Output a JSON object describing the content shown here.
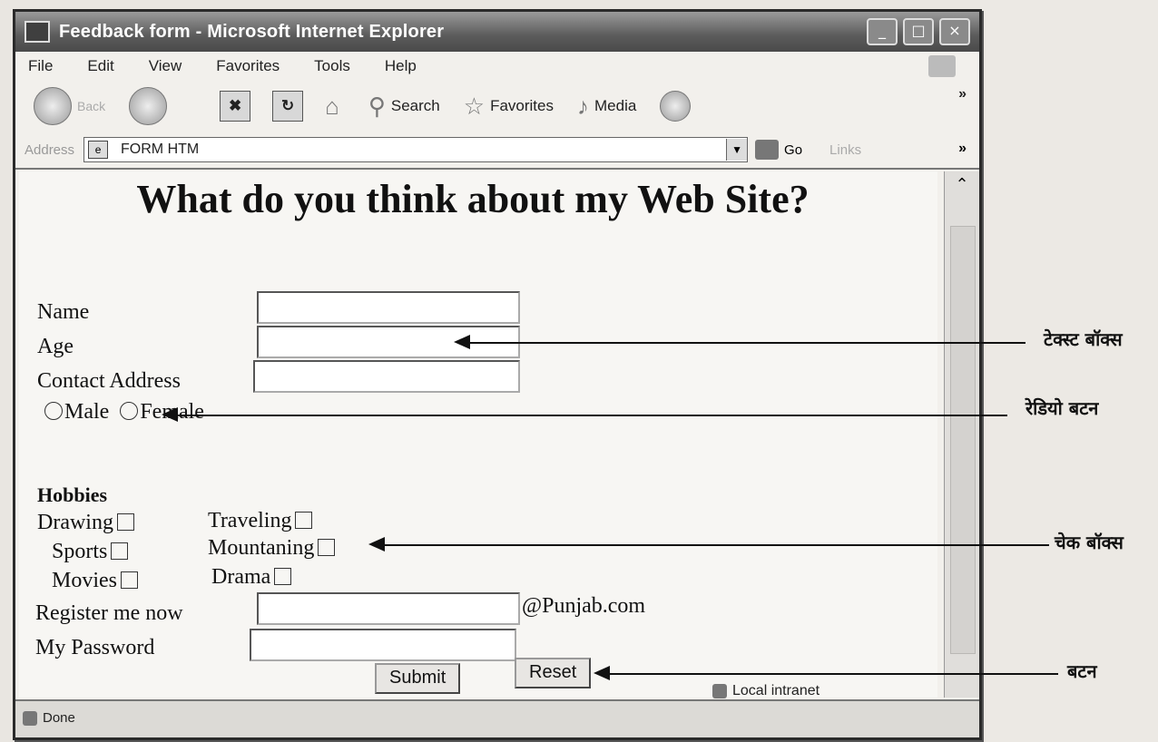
{
  "window": {
    "title": "Feedback form - Microsoft Internet Explorer",
    "controls": [
      "_",
      "□",
      "×"
    ]
  },
  "menu": [
    "File",
    "Edit",
    "View",
    "Favorites",
    "Tools",
    "Help"
  ],
  "toolbar": {
    "back": "Back",
    "search": "Search",
    "favorites": "Favorites",
    "media": "Media",
    "more": "»"
  },
  "address": {
    "label": "Address",
    "value": "FORM HTM",
    "go": "Go",
    "links": "Links",
    "more": "»"
  },
  "page": {
    "heading": "What do you think about my Web Site?",
    "name_label": "Name",
    "age_label": "Age",
    "contact_label": "Contact Address",
    "radio_male": "Male",
    "radio_female": "Female",
    "hobbies_label": "Hobbies",
    "hobbies": {
      "drawing": "Drawing",
      "traveling": "Traveling",
      "sports": "Sports",
      "mountaning": "Mountaning",
      "movies": "Movies",
      "drama": "Drama"
    },
    "register_label": "Register me now",
    "domain_suffix": "@Punjab.com",
    "password_label": "My Password",
    "submit": "Submit",
    "reset": "Reset"
  },
  "status": {
    "left": "Done",
    "right": "Local intranet"
  },
  "annotations": {
    "text_box": "टेक्स्ट बॉक्स",
    "radio_button": "रेडियो बटन",
    "check_box": "चेक बॉक्स",
    "button": "बटन"
  }
}
